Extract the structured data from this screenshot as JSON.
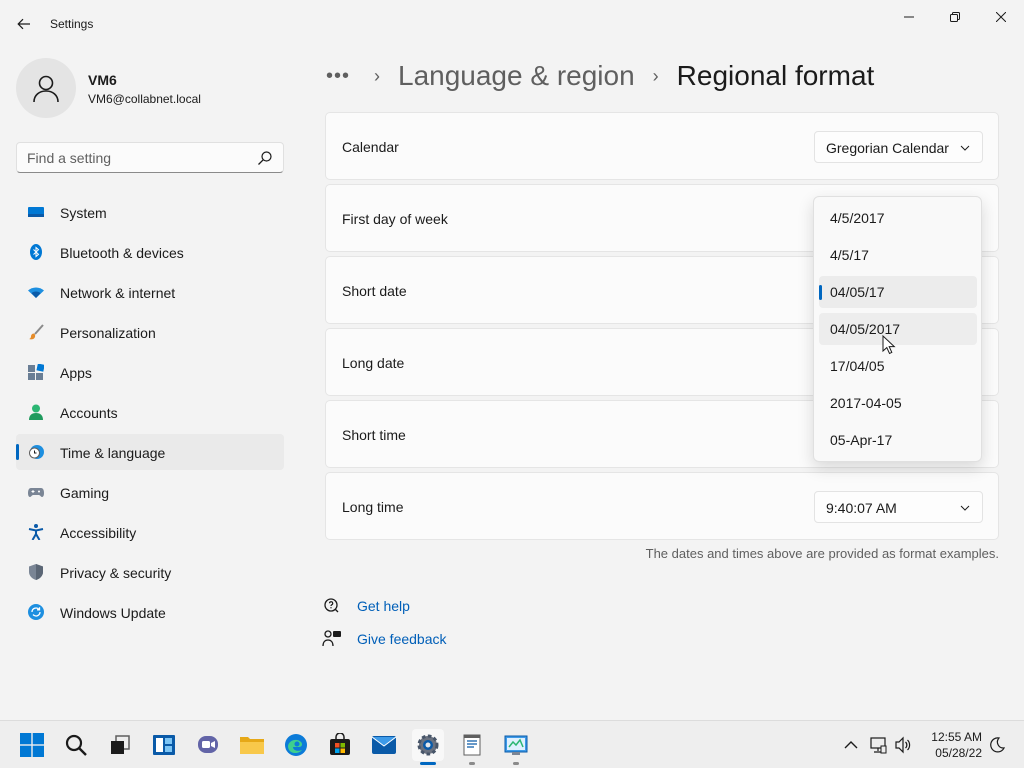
{
  "window": {
    "title": "Settings"
  },
  "profile": {
    "name": "VM6",
    "email": "VM6@collabnet.local"
  },
  "search": {
    "placeholder": "Find a setting"
  },
  "nav": {
    "items": [
      {
        "label": "System",
        "icon": "monitor-icon"
      },
      {
        "label": "Bluetooth & devices",
        "icon": "bluetooth-icon"
      },
      {
        "label": "Network & internet",
        "icon": "wifi-icon"
      },
      {
        "label": "Personalization",
        "icon": "paintbrush-icon"
      },
      {
        "label": "Apps",
        "icon": "apps-icon"
      },
      {
        "label": "Accounts",
        "icon": "person-icon"
      },
      {
        "label": "Time & language",
        "icon": "clock-globe-icon",
        "active": true
      },
      {
        "label": "Gaming",
        "icon": "gamepad-icon"
      },
      {
        "label": "Accessibility",
        "icon": "accessibility-icon"
      },
      {
        "label": "Privacy & security",
        "icon": "shield-icon"
      },
      {
        "label": "Windows Update",
        "icon": "update-icon"
      }
    ]
  },
  "breadcrumb": {
    "more": "•••",
    "parent": "Language & region",
    "current": "Regional format"
  },
  "settings": {
    "calendar": {
      "label": "Calendar",
      "value": "Gregorian Calendar"
    },
    "first_day": {
      "label": "First day of week"
    },
    "short_date": {
      "label": "Short date"
    },
    "long_date": {
      "label": "Long date"
    },
    "short_time": {
      "label": "Short time"
    },
    "long_time": {
      "label": "Long time",
      "value": "9:40:07 AM"
    },
    "note": "The dates and times above are provided as format examples."
  },
  "short_date_options": {
    "items": [
      "4/5/2017",
      "4/5/17",
      "04/05/17",
      "04/05/2017",
      "17/04/05",
      "2017-04-05",
      "05-Apr-17"
    ],
    "selected": "04/05/17",
    "hovered": "04/05/2017"
  },
  "links": {
    "help": "Get help",
    "feedback": "Give feedback"
  },
  "taskbar": {
    "time": "12:55 AM",
    "date": "05/28/22"
  },
  "colors": {
    "accent": "#0067c0",
    "link": "#005fb8"
  }
}
